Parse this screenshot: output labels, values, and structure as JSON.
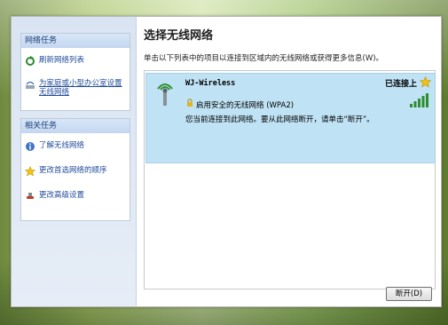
{
  "sidebar": {
    "network_tasks_title": "网络任务",
    "network_tasks": [
      {
        "label": "刷新网络列表",
        "icon": "refresh-icon"
      },
      {
        "label": "为家庭或小型办公室设置无线网络",
        "icon": "wireless-setup-icon"
      }
    ],
    "related_tasks_title": "相关任务",
    "related_tasks": [
      {
        "label": "了解无线网络",
        "icon": "info-icon"
      },
      {
        "label": "更改首选网络的顺序",
        "icon": "star-icon"
      },
      {
        "label": "更改高级设置",
        "icon": "settings-icon"
      }
    ]
  },
  "main": {
    "title": "选择无线网络",
    "description": "单击以下列表中的项目以连接到区域内的无线网络或获得更多信息(W)。",
    "network": {
      "ssid": "WJ-Wireless",
      "status": "已连接上",
      "security": "启用安全的无线网络 (WPA2)",
      "message": "您当前连接到此网络。要从此网络断开，请单击“断开”。",
      "signal_level": 5
    },
    "disconnect_label": "断开(D)"
  },
  "colors": {
    "accent": "#1f4a9a",
    "selected_item": "#bfe2f4",
    "signal": "#2f8f2f"
  }
}
